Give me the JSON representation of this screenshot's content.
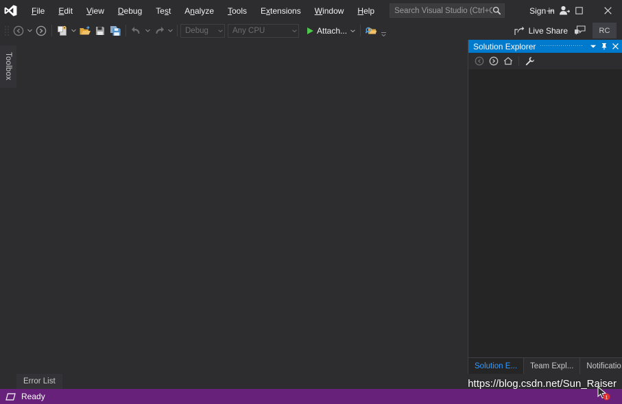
{
  "app": {
    "logo_icon": "visual-studio-logo",
    "theme_bg": "#2d2d30",
    "accent": "#007acc",
    "status_bar_color": "#68217a"
  },
  "menubar": {
    "items": [
      {
        "label": "File",
        "accesskey": "F"
      },
      {
        "label": "Edit",
        "accesskey": "E"
      },
      {
        "label": "View",
        "accesskey": "V"
      },
      {
        "label": "Debug",
        "accesskey": "D"
      },
      {
        "label": "Test",
        "accesskey": "s"
      },
      {
        "label": "Analyze",
        "accesskey": "n"
      },
      {
        "label": "Tools",
        "accesskey": "T"
      },
      {
        "label": "Extensions",
        "accesskey": "x"
      },
      {
        "label": "Window",
        "accesskey": "W"
      },
      {
        "label": "Help",
        "accesskey": "H"
      }
    ]
  },
  "search": {
    "placeholder": "Search Visual Studio (Ctrl+Q)",
    "icon": "search-icon"
  },
  "account": {
    "signin_label": "Sign in",
    "icon": "user-account-icon"
  },
  "window_controls": {
    "minimize": "—",
    "maximize": "□",
    "close": "✕"
  },
  "toolbar": {
    "navigate_back_icon": "navigate-back-icon",
    "navigate_forward_icon": "navigate-forward-icon",
    "new_project_icon": "new-project-icon",
    "open_file_icon": "open-file-icon",
    "save_icon": "save-icon",
    "save_all_icon": "save-all-icon",
    "undo_icon": "undo-icon",
    "redo_icon": "redo-icon",
    "configuration": "Debug",
    "platform": "Any CPU",
    "run_label": "Attach...",
    "run_icon": "play-icon",
    "find_icon": "find-in-files-icon",
    "overflow_icon": "toolbar-overflow-icon"
  },
  "toolbar_right": {
    "live_share_label": "Live Share",
    "live_share_icon": "live-share-icon",
    "feedback_icon": "feedback-icon",
    "user_badge": "RC"
  },
  "toolbox": {
    "label": "Toolbox"
  },
  "solution_explorer": {
    "title": "Solution Explorer",
    "dropdown_icon": "chevron-down-icon",
    "pin_icon": "pin-icon",
    "close_icon": "close-icon",
    "tools": [
      {
        "name": "back-icon"
      },
      {
        "name": "forward-icon"
      },
      {
        "name": "home-icon"
      },
      {
        "name": "wrench-icon"
      }
    ],
    "tabs": [
      {
        "label": "Solution E...",
        "active": true
      },
      {
        "label": "Team Expl...",
        "active": false
      },
      {
        "label": "Notificatio...",
        "active": false
      }
    ]
  },
  "bottom_dock": {
    "error_list_tab": "Error List"
  },
  "statusbar": {
    "icon": "ready-icon",
    "text": "Ready",
    "watermark": "https://blog.csdn.net/Sun_Raiser"
  }
}
